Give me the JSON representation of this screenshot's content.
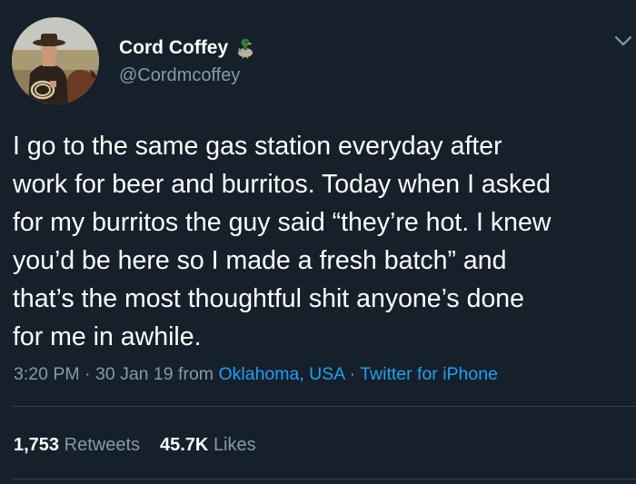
{
  "author": {
    "display_name": "Cord Coffey",
    "handle": "@Cordmcoffey",
    "badge_icon": "duck-emoji-icon",
    "avatar_icon": "cowboy-on-horse-avatar"
  },
  "menu": {
    "icon": "chevron-down-icon"
  },
  "tweet": {
    "lines": [
      "I go to the same gas station everyday after",
      "work for beer and burritos. Today when I asked",
      "for my burritos the guy said “they’re hot. I knew",
      "you’d be here so I made a fresh batch” and",
      "that’s the most thoughtful shit anyone’s done",
      "for me in awhile."
    ]
  },
  "meta": {
    "time": "3:20 PM",
    "sep1": " · ",
    "date": "30 Jan 19",
    "from_label": " from ",
    "location": "Oklahoma, USA",
    "sep2": " · ",
    "source": "Twitter for iPhone"
  },
  "stats": {
    "retweets_count": "1,753",
    "retweets_label": "Retweets",
    "likes_count": "45.7K",
    "likes_label": "Likes"
  },
  "colors": {
    "background": "#15202b",
    "text": "#ffffff",
    "secondary_text": "#8899a6",
    "link": "#1da1f2",
    "divider": "#38444d"
  }
}
